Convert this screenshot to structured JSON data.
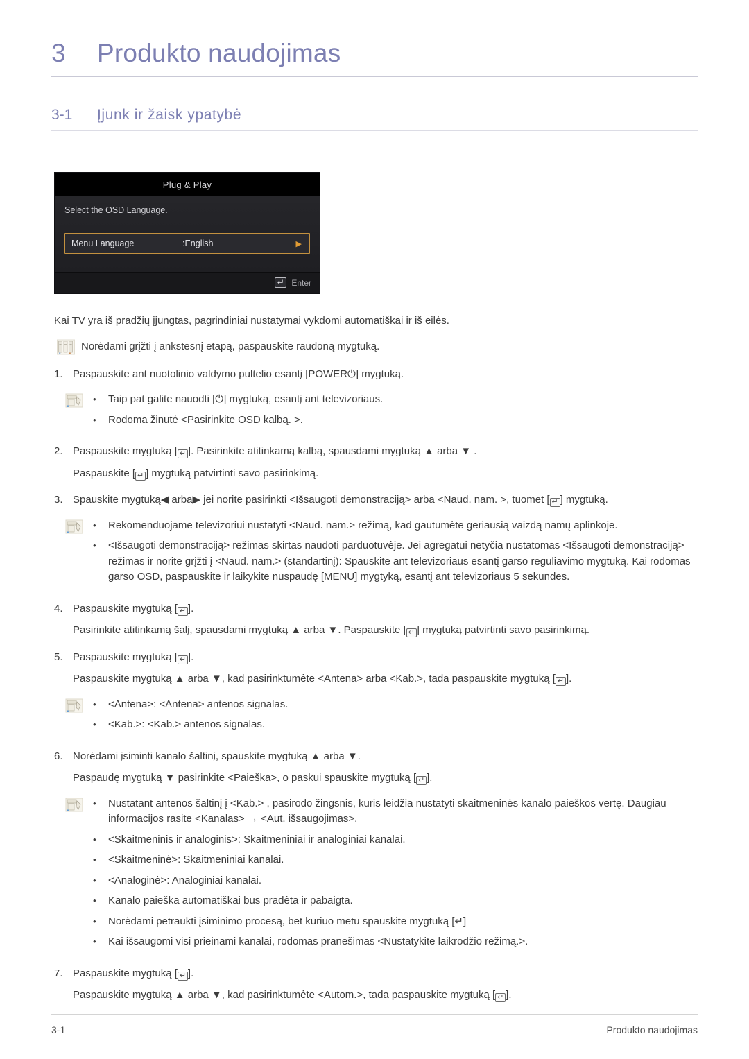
{
  "chapter": {
    "number": "3",
    "title": "Produkto naudojimas"
  },
  "section": {
    "number": "3-1",
    "title": "Įjunk ir žaisk ypatybė"
  },
  "osd": {
    "title": "Plug & Play",
    "prompt": "Select the OSD Language.",
    "row_label": "Menu Language",
    "row_value": ":English",
    "row_arrow": "▶",
    "enter_label": "Enter",
    "enter_key": "↵",
    "border_color": "#c3913f",
    "arrow_color": "#e09b34"
  },
  "intro": "Kai TV yra iš pradžių įjungtas, pagrindiniai nustatymai vykdomi automatiškai ir iš eilės.",
  "note_top": "Norėdami grįžti į ankstesnį etapą, paspauskite raudoną mygtuką.",
  "steps": [
    {
      "num": "1.",
      "text_pre": "Paspauskite ant nuotolinio valdymo pultelio esantį [POWER",
      "power_symbol": "⏻",
      "text_post": "] mygtuką.",
      "bullets": [
        "Taip pat galite nauodti [⏻] mygtuką, esantį ant televizoriaus.",
        "Rodoma žinutė <Pasirinkite OSD kalbą. >."
      ]
    },
    {
      "num": "2.",
      "line1_a": "Paspauskite mygtuką [",
      "line1_b": "]. Pasirinkite atitinkamą kalbą, spausdami mygtuką ▲ arba ▼ .",
      "line2_a": "Paspauskite [",
      "line2_b": "] mygtuką patvirtinti savo pasirinkimą."
    },
    {
      "num": "3.",
      "line_a": "Spauskite mygtuką◀ arba▶ jei norite pasirinkti <Išsaugoti demonstraciją> arba <Naud. nam. >, tuomet [",
      "line_b": "] mygtuką.",
      "bullets": [
        "Rekomenduojame televizoriui nustatyti <Naud. nam.> režimą, kad gautumėte geriausią vaizdą namų aplinkoje.",
        "<Išsaugoti demonstraciją> režimas skirtas naudoti parduotuvėje. Jei agregatui netyčia nustatomas <Išsaugoti demonstraciją> režimas ir norite grįžti į <Naud. nam.> (standartinį): Spauskite ant televizoriaus esantį garso reguliavimo mygtuką. Kai rodomas garso OSD, paspauskite ir laikykite nuspaudę [MENU] mygtyką, esantį ant televizoriaus 5 sekundes."
      ]
    },
    {
      "num": "4.",
      "line1_a": "Paspauskite mygtuką [",
      "line1_b": "].",
      "line2_a": "Pasirinkite atitinkamą šalį, spausdami mygtuką ▲ arba ▼. Paspauskite [",
      "line2_b": "] mygtuką patvirtinti savo pasirinkimą."
    },
    {
      "num": "5.",
      "line1_a": "Paspauskite mygtuką [",
      "line1_b": "].",
      "line2_a": "Paspauskite mygtuką ▲ arba ▼, kad pasirinktumėte <Antena> arba <Kab.>, tada paspauskite mygtuką [",
      "line2_b": "].",
      "bullets": [
        "<Antena>: <Antena> antenos signalas.",
        "<Kab.>: <Kab.> antenos signalas."
      ]
    },
    {
      "num": "6.",
      "line1": "Norėdami įsiminti kanalo šaltinį, spauskite mygtuką ▲ arba ▼.",
      "line2_a": "Paspaudę mygtuką ▼ pasirinkite <Paieška>, o paskui spauskite mygtuką [",
      "line2_b": "].",
      "bullets": [
        "Nustatant antenos šaltinį į <Kab.> , pasirodo žingsnis, kuris leidžia nustatyti skaitmeninės kanalo paieškos vertę. Daugiau informacijos rasite <Kanalas> → <Aut. išsaugojimas>.",
        "<Skaitmeninis ir analoginis>: Skaitmeniniai ir analoginiai kanalai.",
        "<Skaitmeninė>: Skaitmeniniai kanalai.",
        "<Analoginė>: Analoginiai kanalai.",
        "Kanalo paieška automatiškai bus pradėta ir pabaigta."
      ],
      "bullets_b": [
        "Norėdami petraukti įsiminimo procesą, bet kuriuo metu spauskite mygtuką [↵]",
        "Kai išsaugomi visi prieinami kanalai, rodomas pranešimas <Nustatykite laikrodžio režimą.>."
      ]
    },
    {
      "num": "7.",
      "line1_a": "Paspauskite mygtuką [",
      "line1_b": "].",
      "line2_a": "Paspauskite mygtuką ▲ arba ▼, kad pasirinktumėte <Autom.>, tada paspauskite mygtuką [",
      "line2_b": "]."
    }
  ],
  "keycap_glyph": "↵",
  "bullet_glyph": "•",
  "footer": {
    "left": "3-1",
    "right": "Produkto naudojimas"
  },
  "colors": {
    "heading": "#7c7fb2",
    "body_text": "#3c3c3c",
    "osd_header_bg": "#000000",
    "osd_body_bg": "#232327"
  }
}
